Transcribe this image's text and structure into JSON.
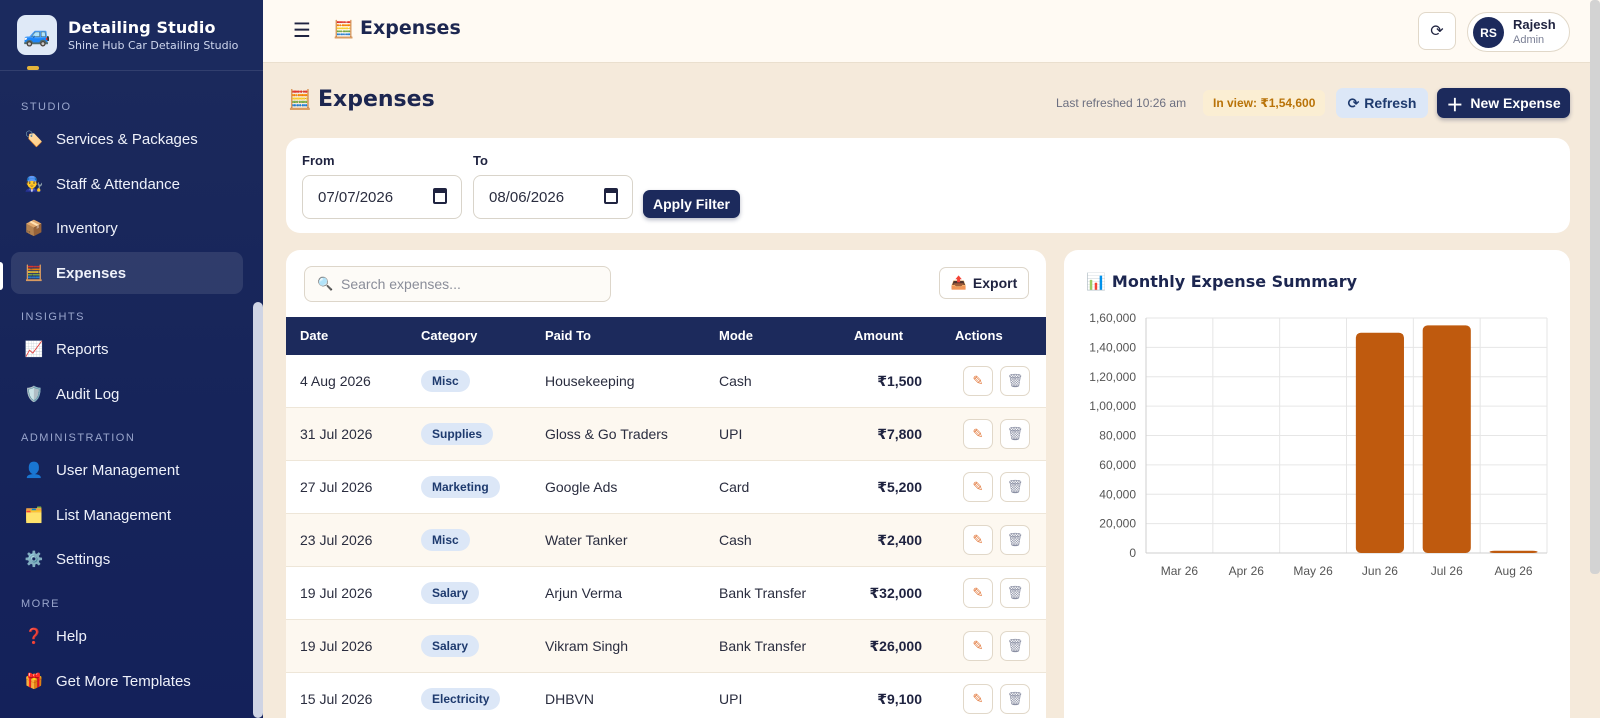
{
  "brand": {
    "title": "Detailing Studio",
    "subtitle": "Shine Hub Car Detailing Studio"
  },
  "sidebar": {
    "sections": {
      "studio": "STUDIO",
      "insights": "INSIGHTS",
      "administration": "ADMINISTRATION",
      "more": "MORE"
    },
    "items": [
      {
        "label": "Services & Packages",
        "icon": "tag-icon"
      },
      {
        "label": "Staff & Attendance",
        "icon": "staff-icon"
      },
      {
        "label": "Inventory",
        "icon": "box-icon"
      },
      {
        "label": "Expenses",
        "icon": "abacus-icon",
        "active": true
      },
      {
        "label": "Reports",
        "icon": "chart-icon"
      },
      {
        "label": "Audit Log",
        "icon": "shield-icon"
      },
      {
        "label": "User Management",
        "icon": "user-icon"
      },
      {
        "label": "List Management",
        "icon": "folder-icon"
      },
      {
        "label": "Settings",
        "icon": "gear-icon"
      },
      {
        "label": "Help",
        "icon": "question-icon"
      },
      {
        "label": "Get More Templates",
        "icon": "gift-icon"
      }
    ]
  },
  "topbar": {
    "title": "Expenses",
    "user": {
      "initials": "RS",
      "name": "Rajesh",
      "role": "Admin"
    }
  },
  "page": {
    "title": "Expenses",
    "last_refreshed": "Last refreshed 10:26 am",
    "in_view": "In view: ₹1,54,600",
    "refresh_label": "Refresh",
    "new_label": "New Expense"
  },
  "filter": {
    "from_label": "From",
    "from_value": "07/07/2026",
    "to_label": "To",
    "to_value": "08/06/2026",
    "apply_label": "Apply Filter"
  },
  "table": {
    "search_placeholder": "Search expenses...",
    "export_label": "Export",
    "columns": [
      "Date",
      "Category",
      "Paid To",
      "Mode",
      "Amount",
      "Actions"
    ],
    "rows": [
      {
        "date": "4 Aug 2026",
        "category": "Misc",
        "paid_to": "Housekeeping",
        "mode": "Cash",
        "amount": "₹1,500"
      },
      {
        "date": "31 Jul 2026",
        "category": "Supplies",
        "paid_to": "Gloss & Go Traders",
        "mode": "UPI",
        "amount": "₹7,800"
      },
      {
        "date": "27 Jul 2026",
        "category": "Marketing",
        "paid_to": "Google Ads",
        "mode": "Card",
        "amount": "₹5,200"
      },
      {
        "date": "23 Jul 2026",
        "category": "Misc",
        "paid_to": "Water Tanker",
        "mode": "Cash",
        "amount": "₹2,400"
      },
      {
        "date": "19 Jul 2026",
        "category": "Salary",
        "paid_to": "Arjun Verma",
        "mode": "Bank Transfer",
        "amount": "₹32,000"
      },
      {
        "date": "19 Jul 2026",
        "category": "Salary",
        "paid_to": "Vikram Singh",
        "mode": "Bank Transfer",
        "amount": "₹26,000"
      },
      {
        "date": "15 Jul 2026",
        "category": "Electricity",
        "paid_to": "DHBVN",
        "mode": "UPI",
        "amount": "₹9,100"
      }
    ]
  },
  "chart_data": {
    "type": "bar",
    "title": "Monthly Expense Summary",
    "categories": [
      "Mar 26",
      "Apr 26",
      "May 26",
      "Jun 26",
      "Jul 26",
      "Aug 26"
    ],
    "values": [
      0,
      0,
      0,
      150000,
      155000,
      1500
    ],
    "ylim": [
      0,
      160000
    ],
    "yticks": [
      "0",
      "20,000",
      "40,000",
      "60,000",
      "80,000",
      "1,00,000",
      "1,20,000",
      "1,40,000",
      "1,60,000"
    ],
    "grid": true,
    "color": "#bf5a0e"
  },
  "colors": {
    "navy": "#1c2a5c",
    "accent": "#e0702f",
    "bar": "#bf5a0e"
  }
}
